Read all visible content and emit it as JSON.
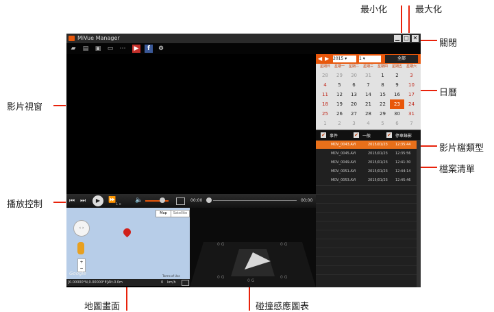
{
  "callouts": {
    "minimize": "最小化",
    "maximize": "最大化",
    "close": "關閉",
    "video_window": "影片視窗",
    "calendar": "日曆",
    "file_type": "影片檔類型",
    "file_list": "檔案清單",
    "playback_control": "播放控制",
    "map_view": "地圖畫面",
    "g_sensor": "碰撞感應圖表"
  },
  "window": {
    "title": "MiVue Manager"
  },
  "calendar": {
    "year": "2015",
    "month": "1",
    "all_button": "全部",
    "weekdays": [
      "星期日",
      "星期一",
      "星期二",
      "星期三",
      "星期四",
      "星期五",
      "星期六"
    ],
    "rows": [
      [
        "28",
        "29",
        "30",
        "31",
        "1",
        "2",
        "3"
      ],
      [
        "4",
        "5",
        "6",
        "7",
        "8",
        "9",
        "10"
      ],
      [
        "11",
        "12",
        "13",
        "14",
        "15",
        "16",
        "17"
      ],
      [
        "18",
        "19",
        "20",
        "21",
        "22",
        "23",
        "24"
      ],
      [
        "25",
        "26",
        "27",
        "28",
        "29",
        "30",
        "31"
      ],
      [
        "1",
        "2",
        "3",
        "4",
        "5",
        "6",
        "7"
      ]
    ],
    "selected_day": "23"
  },
  "filters": [
    "事件",
    "一般",
    "停車錄影"
  ],
  "files": [
    {
      "name": "MOV_0043.AVI",
      "date": "2015/01/23",
      "time": "12:35:44"
    },
    {
      "name": "MOV_0045.AVI",
      "date": "2015/01/23",
      "time": "12:35:56"
    },
    {
      "name": "MOV_0049.AVI",
      "date": "2015/01/23",
      "time": "12:41:30"
    },
    {
      "name": "MOV_0051.AVI",
      "date": "2015/01/23",
      "time": "12:44:14"
    },
    {
      "name": "MOV_0053.AVI",
      "date": "2015/01/23",
      "time": "12:45:46"
    }
  ],
  "playback": {
    "speed": "1 x",
    "time_start": "00:00",
    "time_end": "00:00"
  },
  "map": {
    "btn_map": "Map",
    "btn_satellite": "Satellite",
    "terms": "Terms of Use",
    "google": "Google",
    "coords": "[0.00000°N,0.00000°E]Alt.0.0m",
    "speed": "0",
    "speed_unit": "km/h"
  },
  "gsensor": {
    "label": "0 G"
  },
  "colors": {
    "accent": "#e8570b",
    "callout_line": "#e8220b",
    "selected_row": "#e8701a"
  }
}
